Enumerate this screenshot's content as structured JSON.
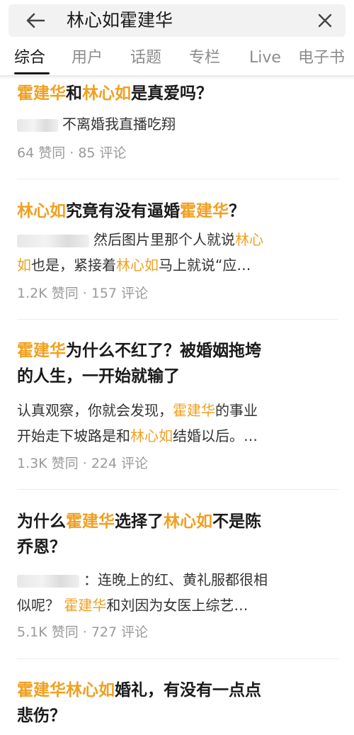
{
  "search": {
    "query": "林心如霍建华"
  },
  "tabs": [
    "综合",
    "用户",
    "话题",
    "专栏",
    "Live",
    "电子书"
  ],
  "results": [
    {
      "title": [
        [
          "霍建华",
          true
        ],
        [
          "和",
          false
        ],
        [
          "林心如",
          true
        ],
        [
          "是真爱吗？",
          false
        ]
      ],
      "excerpt_lines": [
        [
          [
            "不离婚我直播吃翔",
            false
          ]
        ]
      ],
      "meta": "64 赞同 · 85 评论"
    },
    {
      "title": [
        [
          "林心如",
          true
        ],
        [
          "究竟有没有逼婚",
          false
        ],
        [
          "霍建华",
          true
        ],
        [
          "？",
          false
        ]
      ],
      "excerpt_lines": [
        [
          [
            "然后图片里那个人就说",
            false
          ],
          [
            "林心",
            true
          ]
        ],
        [
          [
            "如",
            true
          ],
          [
            "也是，紧接着",
            false
          ],
          [
            "林心如",
            true
          ],
          [
            "马上就说“应…",
            false
          ]
        ]
      ],
      "meta": "1.2K 赞同 · 157 评论"
    },
    {
      "title_lines": [
        [
          [
            "霍建华",
            true
          ],
          [
            "为什么不红了？被婚姻拖垮",
            false
          ]
        ],
        [
          [
            "的人生，一开始就输了",
            false
          ]
        ]
      ],
      "excerpt_lines": [
        [
          [
            "认真观察，你就会发现，",
            false
          ],
          [
            "霍建华",
            true
          ],
          [
            "的事业",
            false
          ]
        ],
        [
          [
            "开始走下坡路是和",
            false
          ],
          [
            "林心如",
            true
          ],
          [
            "结婚以后。…",
            false
          ]
        ]
      ],
      "meta": "1.3K 赞同 · 224 评论"
    },
    {
      "title_lines": [
        [
          [
            "为什么",
            false
          ],
          [
            "霍建华",
            true
          ],
          [
            "选择了",
            false
          ],
          [
            "林心如",
            true
          ],
          [
            "不是陈",
            false
          ]
        ],
        [
          [
            "乔恩？",
            false
          ]
        ]
      ],
      "excerpt_lines": [
        [
          [
            "：连晚上的红、黄礼服都很相",
            false
          ]
        ],
        [
          [
            "似呢？ ",
            false
          ],
          [
            "霍建华",
            true
          ],
          [
            "和刘因为女医上综艺…",
            false
          ]
        ]
      ],
      "meta": "5.1K 赞同 · 727 评论"
    },
    {
      "title_lines": [
        [
          [
            "霍建华林心如",
            true
          ],
          [
            "婚礼，有没有一点点",
            false
          ]
        ],
        [
          [
            "悲伤？",
            false
          ]
        ]
      ]
    }
  ],
  "colors": {
    "highlight": "#f0a020",
    "meta": "#9a9a9a",
    "search_bg": "#f2f2f2"
  }
}
